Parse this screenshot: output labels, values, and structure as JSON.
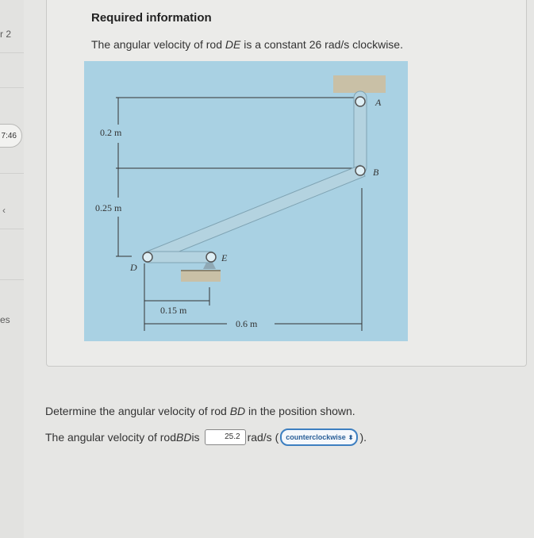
{
  "sidebar": {
    "label_1": "r 2",
    "timer": "7:46",
    "chevron": "‹",
    "label_2": "es"
  },
  "problem": {
    "heading": "Required information",
    "statement_prefix": "The angular velocity of rod ",
    "statement_rod": "DE",
    "statement_suffix": " is a constant 26 rad/s clockwise."
  },
  "figure": {
    "labels": {
      "A": "A",
      "B": "B",
      "D": "D",
      "E": "E",
      "dim_top": "0.2 m",
      "dim_mid": "0.25 m",
      "dim_de": "0.15 m",
      "dim_width": "0.6 m"
    }
  },
  "question": {
    "prefix": "Determine the angular velocity of rod ",
    "rod": "BD",
    "suffix": " in the position shown."
  },
  "answer": {
    "prefix": "The angular velocity of rod ",
    "rod": "BD",
    "is": " is",
    "value": "25.2",
    "unit": "rad/s (",
    "direction": "counterclockwise",
    "close": ")."
  },
  "colors": {
    "figure_bg": "#a9d1e3",
    "rod": "#b4d3e0",
    "ground": "#c9c0a6",
    "select_accent": "#3d7fc0"
  },
  "icons": {
    "select_caret": "⬍"
  }
}
